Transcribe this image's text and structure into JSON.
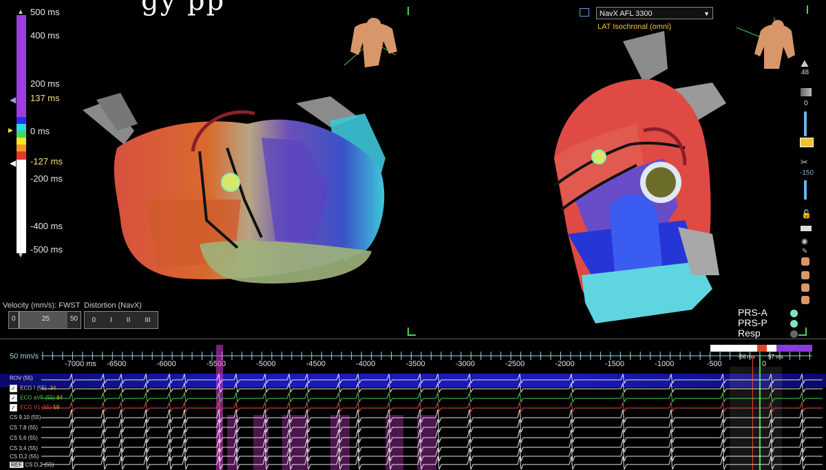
{
  "top_title_fragment": "gy pp",
  "color_scale": {
    "labels": [
      {
        "id": "500",
        "text": "500 ms"
      },
      {
        "id": "400",
        "text": "400 ms"
      },
      {
        "id": "200",
        "text": "200 ms"
      },
      {
        "id": "137",
        "text": "137 ms"
      },
      {
        "id": "0",
        "text": "0 ms"
      },
      {
        "id": "m127",
        "text": "-127 ms"
      },
      {
        "id": "m200",
        "text": "-200 ms"
      },
      {
        "id": "m400",
        "text": "-400 ms"
      },
      {
        "id": "m500",
        "text": "-500 ms"
      }
    ]
  },
  "velocity_panel": {
    "label": "Velocity (mm/s): FWST",
    "ticks": [
      "0",
      "25",
      "50"
    ]
  },
  "distortion_panel": {
    "label": "Distortion (NavX)",
    "ticks": [
      "0",
      "I",
      "II",
      "III"
    ]
  },
  "map_selector": {
    "value": "NavX AFL 3300",
    "sublabel": "LAT Isochronal (omni)"
  },
  "right_tools": {
    "value_48": "48",
    "value_0": "0",
    "value_m150": "-150"
  },
  "legend": [
    {
      "label": "PRS-A",
      "color": "#7fe3c4"
    },
    {
      "label": "PRS-P",
      "color": "#7fe3c4"
    },
    {
      "label": "Resp",
      "color": "#666666"
    }
  ],
  "timeline": {
    "speed": "50 mm/s",
    "ticks": [
      "-7000 ms",
      "-6500",
      "-6000",
      "-5500",
      "-5000",
      "-4500",
      "-4000",
      "-3500",
      "-3000",
      "-2500",
      "-2000",
      "-1500",
      "-1000",
      "-500",
      "0"
    ],
    "window_left": "-56 ms",
    "window_right": "57 ms",
    "channels": [
      {
        "label": "ROV (55)",
        "checked": false
      },
      {
        "label": "ECG I (55)",
        "value": "-34",
        "checked": true,
        "color": "#e8e8e8"
      },
      {
        "label": "ECG aVF (55)",
        "value": "84",
        "checked": true,
        "color": "#54d24f"
      },
      {
        "label": "ECG V1 (55)",
        "value": "59",
        "checked": true,
        "color": "#e0534e"
      },
      {
        "label": "CS 9,10 (55)",
        "checked": false
      },
      {
        "label": "CS 7,8 (55)",
        "checked": false
      },
      {
        "label": "CS 5,6 (55)",
        "checked": false
      },
      {
        "label": "CS 3,4 (55)",
        "checked": false
      },
      {
        "label": "CS D,2 (55)",
        "checked": false
      },
      {
        "label": "CS D,2 (55)",
        "ref": "REF",
        "checked": false
      }
    ]
  }
}
